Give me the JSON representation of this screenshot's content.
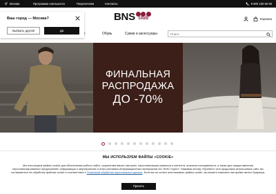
{
  "topbar": {
    "location": "Москва",
    "links": [
      "Программа лояльности",
      "Покупателям",
      "Контакты"
    ],
    "phone": "8 800 100 55 59"
  },
  "header": {
    "logo_text": "BNS",
    "logo_sub": "club",
    "cart_label": "Корзина",
    "brand_color": "#8a1d3c"
  },
  "nav": {
    "items": [
      "ьё",
      "Обувь",
      "Сумки и аксессуары"
    ],
    "search_placeholder": "Поиск"
  },
  "city_popup": {
    "question": "Ваш город — Москва?",
    "other_button": "Выбрать другой",
    "yes_button": "Да"
  },
  "banner": {
    "line1": "ФИНАЛЬНАЯ",
    "line2": "РАСПРОДАЖА",
    "line3": "ДО -70%",
    "slide_count": 12,
    "active_slide": 1
  },
  "cookie": {
    "title": "МЫ ИСПОЛЬЗУЕМ ФАЙЛЫ «COOKIE»",
    "text_before": "Мы используем файлы cookie для обеспечения работы сайта, сохранения ваших настроек, персонализации сервисов и контента, анализа посещаемости, а также для предоставления персонализированных предложений, информации о мероприятиях и иных рекламно-информационных материалов АО «БНС Групп». Нажимая кнопку «Принять» или продолжая использовать сайт, вы соглашаетесь на обработку файлов cookie в соответствии с ",
    "link_text": "Политикой обработки персональных данных",
    "text_after": ". Если вы не хотите использовать файлы cookie, вы можете изменить настройки своего браузера.",
    "accept_button": "Принять"
  }
}
